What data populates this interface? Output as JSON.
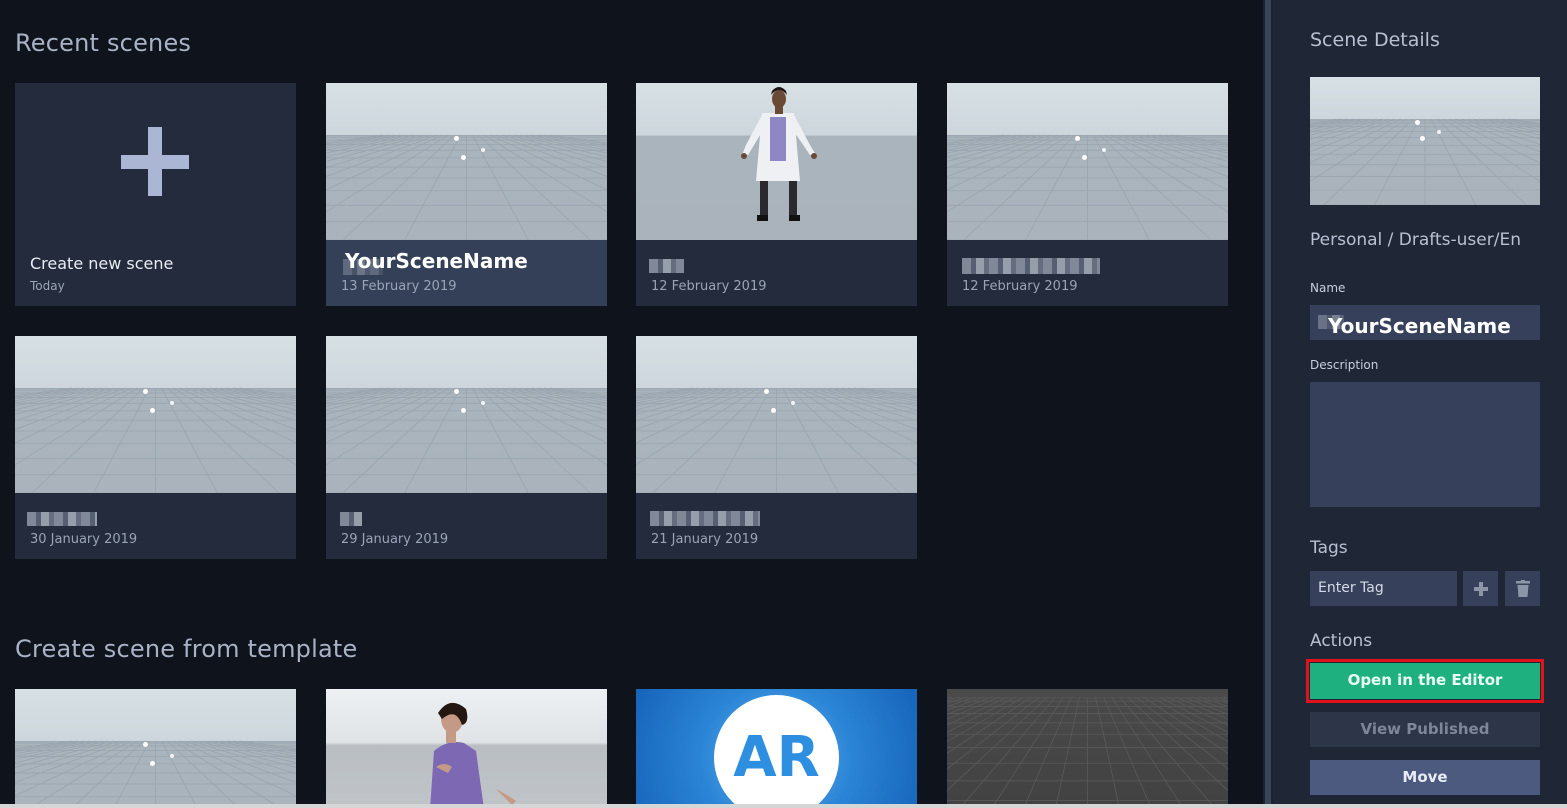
{
  "main": {
    "recent_title": "Recent scenes",
    "template_title": "Create scene from template",
    "recent_cards": [
      {
        "title": "Create new scene",
        "date": "Today",
        "kind": "create"
      },
      {
        "title": "YourSceneName",
        "date": "13 February 2019",
        "kind": "floor",
        "selected": true
      },
      {
        "title": "",
        "date": "12 February 2019",
        "kind": "doctor"
      },
      {
        "title": "",
        "date": "12 February 2019",
        "kind": "floor"
      },
      {
        "title": "",
        "date": "30 January 2019",
        "kind": "floor"
      },
      {
        "title": "",
        "date": "29 January 2019",
        "kind": "floor"
      },
      {
        "title": "",
        "date": "21 January 2019",
        "kind": "floor"
      }
    ],
    "template_cards": [
      {
        "kind": "floor"
      },
      {
        "kind": "host"
      },
      {
        "kind": "ar",
        "label": "AR"
      },
      {
        "kind": "dark-floor"
      }
    ]
  },
  "panel": {
    "title": "Scene Details",
    "path": "Personal / Drafts-user/En",
    "name_label": "Name",
    "name_value": "YourSceneName",
    "description_label": "Description",
    "tags_title": "Tags",
    "tag_placeholder": "Enter Tag",
    "actions_title": "Actions",
    "open_label": "Open in the Editor",
    "view_label": "View Published",
    "move_label": "Move"
  },
  "colors": {
    "accent_green": "#1fb07f",
    "highlight_red": "#e0121b",
    "panel_bg": "#1f2636",
    "card_bg": "#232b3c"
  },
  "icons": {
    "add": "plus-icon",
    "add_tag": "plus-icon",
    "delete_tag": "trash-icon"
  }
}
